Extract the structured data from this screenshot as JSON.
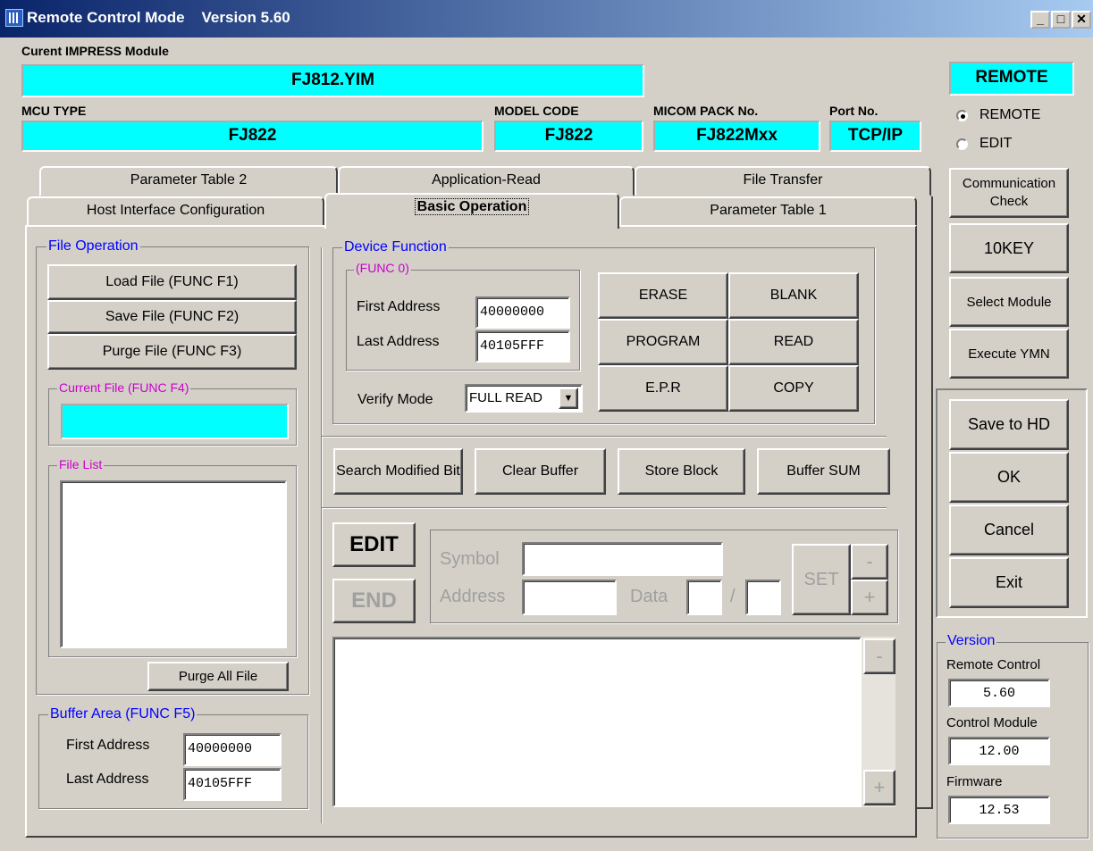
{
  "window": {
    "title": "Remote Control Mode",
    "version_label": "Version 5.60"
  },
  "module": {
    "label": "Curent IMPRESS Module",
    "value": "FJ812.YIM"
  },
  "mcu": {
    "label": "MCU TYPE",
    "value": "FJ822"
  },
  "model": {
    "label": "MODEL CODE",
    "value": "FJ822"
  },
  "micom": {
    "label": "MICOM PACK No.",
    "value": "FJ822Mxx"
  },
  "port": {
    "label": "Port No.",
    "value": "TCP/IP"
  },
  "mode": {
    "badge": "REMOTE",
    "options": [
      "REMOTE",
      "EDIT"
    ],
    "selected": "REMOTE"
  },
  "tabs": {
    "row1": [
      "Parameter Table 2",
      "Application-Read",
      "File Transfer"
    ],
    "row2": [
      "Host Interface Configuration",
      "Basic Operation",
      "Parameter Table 1"
    ],
    "active": "Basic Operation"
  },
  "file_operation": {
    "title": "File Operation",
    "load": "Load File   (FUNC F1)",
    "save": "Save File   (FUNC F2)",
    "purge": "Purge File (FUNC F3)",
    "current_file_title": "Current File (FUNC F4)",
    "current_file": "",
    "file_list_title": "File List",
    "purge_all": "Purge All File"
  },
  "buffer_area": {
    "title": "Buffer Area (FUNC F5)",
    "first_label": "First  Address",
    "first": "40000000",
    "last_label": "Last  Address",
    "last": "40105FFF"
  },
  "device_function": {
    "title": "Device Function",
    "func0_title": "(FUNC 0)",
    "first_label": "First  Address",
    "first": "40000000",
    "last_label": "Last  Address",
    "last": "40105FFF",
    "verify_label": "Verify Mode",
    "verify_value": "FULL READ",
    "buttons": [
      "ERASE",
      "BLANK",
      "PROGRAM",
      "READ",
      "E.P.R",
      "COPY"
    ]
  },
  "buffer_buttons": {
    "search": "Search Modified Bit",
    "clear": "Clear Buffer",
    "store": "Store Block",
    "sum": "Buffer SUM"
  },
  "editor": {
    "edit": "EDIT",
    "end": "END",
    "symbol_label": "Symbol",
    "address_label": "Address",
    "data_label": "Data",
    "slash": "/",
    "set": "SET",
    "minus": "-",
    "plus": "+"
  },
  "log": {
    "minus": "-",
    "plus": "+"
  },
  "right_panel": {
    "comm_check": "Communication Check",
    "tenkey": "10KEY",
    "select_module": "Select Module",
    "execute_ymn": "Execute YMN",
    "save_hd": "Save to HD",
    "ok": "OK",
    "cancel": "Cancel",
    "exit": "Exit"
  },
  "version": {
    "title": "Version",
    "remote_label": "Remote Control",
    "remote": "5.60",
    "module_label": "Control Module",
    "module": "12.00",
    "firmware_label": "Firmware",
    "firmware": "12.53"
  },
  "colors": {
    "accent": "#00ffff",
    "title_from": "#0a246a",
    "title_to": "#a6caf0",
    "group_title": "#0000ff",
    "sub_title": "#cc00cc"
  }
}
